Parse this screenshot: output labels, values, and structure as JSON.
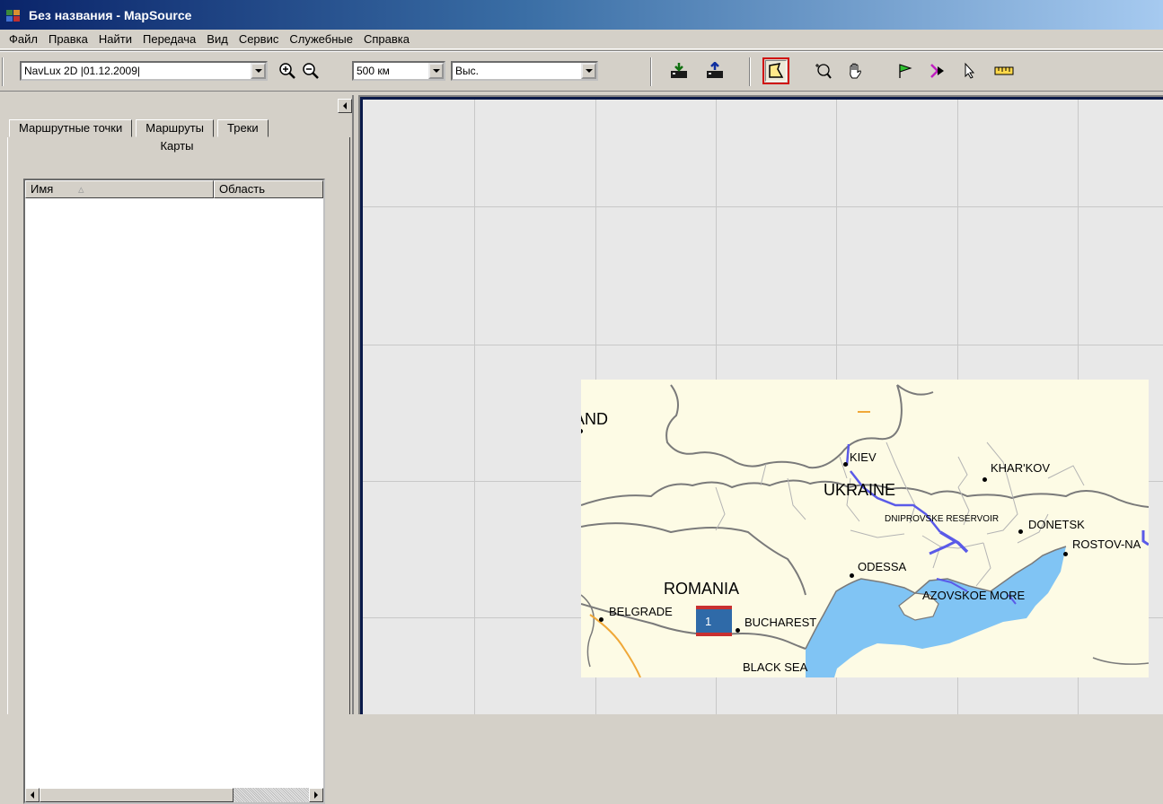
{
  "window": {
    "title": "Без названия - MapSource"
  },
  "menu": [
    "Файл",
    "Правка",
    "Найти",
    "Передача",
    "Вид",
    "Сервис",
    "Служебные",
    "Справка"
  ],
  "toolbar": {
    "map_product": "NavLux 2D |01.12.2009|",
    "zoom_scale": "500 км",
    "detail_level": "Выс.",
    "icons": [
      "zoom-in-icon",
      "zoom-out-icon",
      "receive-from-device-icon",
      "send-to-device-icon",
      "map-select-tool-icon",
      "zoom-tool-icon",
      "hand-pan-icon",
      "waypoint-flag-icon",
      "route-tool-icon",
      "pointer-select-icon",
      "measure-distance-icon"
    ],
    "active_tool": "map-select-tool-icon"
  },
  "left_panel": {
    "tabs": [
      "Маршрутные точки",
      "Маршруты",
      "Треки"
    ],
    "second_row_tab": "Карты",
    "list": {
      "columns": [
        "Имя",
        "Область"
      ],
      "sorted_by": "Имя",
      "rows": []
    }
  },
  "map": {
    "overview_tile_label": "1",
    "labels": {
      "poland": "POLAND",
      "kiev": "KIEV",
      "kharkov": "KHAR'KOV",
      "ukraine": "UKRAINE",
      "dniprovske": "DNIPROVSKE RESERVOIR",
      "donetsk": "DONETSK",
      "rostov": "ROSTOV-NA",
      "odessa": "ODESSA",
      "romania": "ROMANIA",
      "azov": "AZOVSKOE MORE",
      "belgrade": "BELGRADE",
      "bucharest": "BUCHAREST",
      "black_sea": "BLACK SEA"
    },
    "colors": {
      "land": "#fdfbe5",
      "sea": "#80c4f4",
      "grid_bg": "#e8e8e8",
      "border_lines": "#7a7a7a",
      "river_reservoir": "#5a5ae8"
    }
  }
}
